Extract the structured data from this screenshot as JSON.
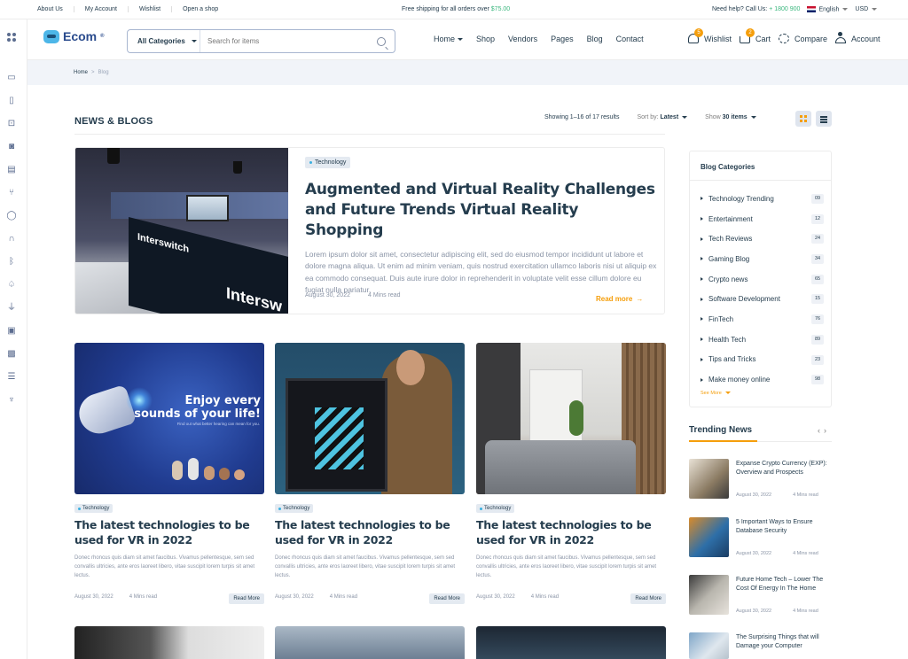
{
  "topbar": {
    "links": [
      "About Us",
      "My Account",
      "Wishlist",
      "Open a shop"
    ],
    "promo_text": "Free shipping for all orders over",
    "promo_amount": "$75.00",
    "help_text": "Need help? Call Us:",
    "phone": "+ 1800 900",
    "language": "English",
    "currency": "USD"
  },
  "header": {
    "logo": "Ecom",
    "logo_mark": "®",
    "search": {
      "category": "All Categories",
      "placeholder": "Search for items"
    },
    "nav": [
      "Home",
      "Shop",
      "Vendors",
      "Pages",
      "Blog",
      "Contact"
    ],
    "wishlist": {
      "label": "Wishlist",
      "count": "5"
    },
    "cart": {
      "label": "Cart",
      "count": "2"
    },
    "compare": "Compare",
    "account": "Account"
  },
  "breadcrumb": {
    "home": "Home",
    "sep": ">",
    "current": "Blog"
  },
  "page": {
    "title": "NEWS & BLOGS",
    "showing": "Showing 1–16 of 17 results",
    "sort_label": "Sort by:",
    "sort_value": "Latest",
    "show_label": "Show",
    "show_value": "30 items"
  },
  "featured": {
    "tag": "Technology",
    "title": "Augmented and Virtual Reality Challenges and Future Trends Virtual Reality Shopping",
    "excerpt": "Lorem ipsum dolor sit amet, consectetur adipiscing elit, sed do eiusmod tempor incididunt ut labore et dolore magna aliqua. Ut enim ad minim veniam, quis nostrud exercitation ullamco laboris nisi ut aliquip ex ea commodo consequat. Duis aute irure dolor in reprehenderit in voluptate velit esse cillum dolore eu fugiat nulla pariatur.",
    "date": "August 30, 2022",
    "read_time": "4 Mins read",
    "read_more": "Read more",
    "image_text_1": "Interswitch",
    "image_text_2": "Intersw"
  },
  "posts": [
    {
      "tag": "Technology",
      "title": "The latest technologies to be used for VR in 2022",
      "excerpt": "Donec rhoncus quis diam sit amet faucibus. Vivamus pellentesque, sem sed convallis ultricies, ante eros laoreet libero, vitae suscipit lorem turpis sit amet lectus.",
      "date": "August 30, 2022",
      "read_time": "4 Mins read",
      "button": "Read More",
      "image_headline_1": "Enjoy every",
      "image_headline_2": "sounds of your life!",
      "image_sub": "Find out what better hearing can mean for you."
    },
    {
      "tag": "Technology",
      "title": "The latest technologies to be used for VR in 2022",
      "excerpt": "Donec rhoncus quis diam sit amet faucibus. Vivamus pellentesque, sem sed convallis ultricies, ante eros laoreet libero, vitae suscipit lorem turpis sit amet lectus.",
      "date": "August 30, 2022",
      "read_time": "4 Mins read",
      "button": "Read More"
    },
    {
      "tag": "Technology",
      "title": "The latest technologies to be used for VR in 2022",
      "excerpt": "Donec rhoncus quis diam sit amet faucibus. Vivamus pellentesque, sem sed convallis ultricies, ante eros laoreet libero, vitae suscipit lorem turpis sit amet lectus.",
      "date": "August 30, 2022",
      "read_time": "4 Mins read",
      "button": "Read More"
    }
  ],
  "sidebar": {
    "categories_title": "Blog Categories",
    "categories": [
      {
        "name": "Technology Trending",
        "count": "09"
      },
      {
        "name": "Entertainment",
        "count": "12"
      },
      {
        "name": "Tech Reviews",
        "count": "24"
      },
      {
        "name": "Gaming Blog",
        "count": "34"
      },
      {
        "name": "Crypto news",
        "count": "65"
      },
      {
        "name": "Software Development",
        "count": "15"
      },
      {
        "name": "FinTech",
        "count": "76"
      },
      {
        "name": "Health Tech",
        "count": "89"
      },
      {
        "name": "Tips and Tricks",
        "count": "23"
      },
      {
        "name": "Make money online",
        "count": "98"
      }
    ],
    "see_more": "See More",
    "trending_title": "Trending News",
    "trending": [
      {
        "title": "Expanse Crypto Currency (EXP): Overview and Prospects",
        "date": "August 30, 2022",
        "read_time": "4 Mins read"
      },
      {
        "title": "5 Important Ways to Ensure Database Security",
        "date": "August 30, 2022",
        "read_time": "4 Mins read"
      },
      {
        "title": "Future Home Tech – Lower The Cost Of Energy In The Home",
        "date": "August 30, 2022",
        "read_time": "4 Mins read"
      },
      {
        "title": "The Surprising Things that will Damage your Computer",
        "date": "",
        "read_time": ""
      }
    ]
  },
  "colors": {
    "accent": "#f59e0b",
    "green": "#3bb77e",
    "text": "#253d4e",
    "muted": "#8a94a6"
  }
}
